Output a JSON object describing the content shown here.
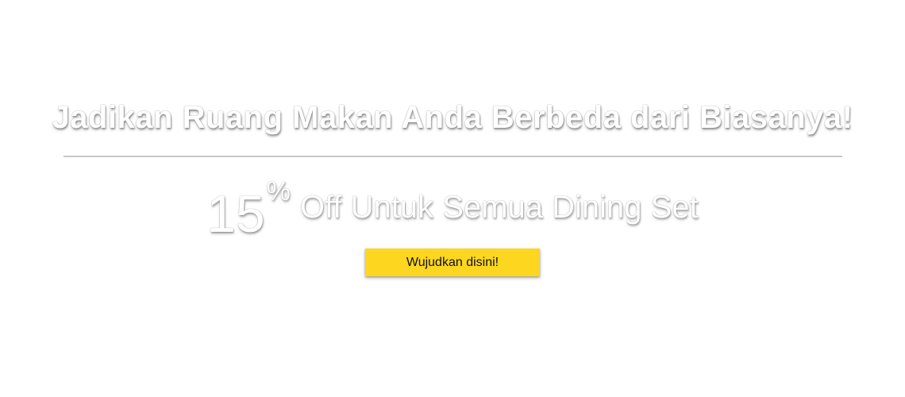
{
  "banner": {
    "headline": "Jadikan Ruang Makan Anda Berbeda dari Biasanya!",
    "offer": {
      "number": "15",
      "percent_sign": "%",
      "text": "Off Untuk Semua Dining Set"
    },
    "cta_label": "Wujudkan disini!"
  },
  "colors": {
    "background": "#ffffff",
    "cta_background": "#fdd620",
    "cta_text": "#111111",
    "divider": "#c9c9c9",
    "headline_text": "#ffffff"
  }
}
